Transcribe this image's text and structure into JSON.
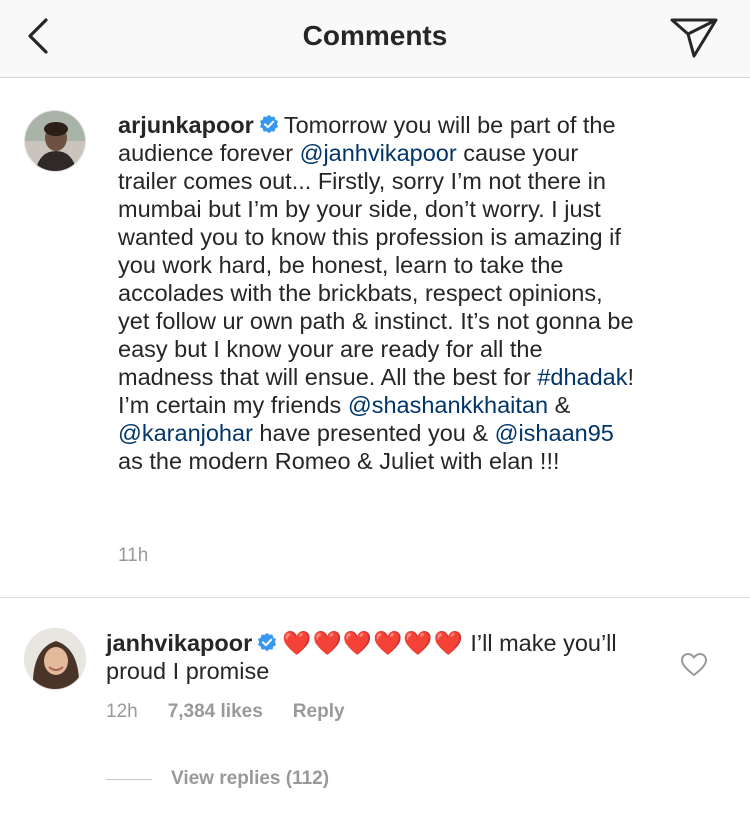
{
  "header": {
    "title": "Comments",
    "back_icon": "chevron-left-icon",
    "send_icon": "paper-plane-icon"
  },
  "comments": [
    {
      "username": "arjunkapoor",
      "verified": true,
      "segments": [
        {
          "text": "Tomorrow you will be part of the audience forever ",
          "type": "text"
        },
        {
          "text": "@janhvikapoor",
          "type": "mention"
        },
        {
          "text": " cause your trailer comes out... Firstly, sorry I’m not there in mumbai but I’m by your side, don’t worry. I just wanted you to know this profession is amazing if you work hard, be honest, learn to take the accolades with the brickbats, respect opinions, yet follow ur own path & instinct. It’s not gonna be easy but I know your are ready for all the madness that will ensue. All the best for ",
          "type": "text"
        },
        {
          "text": "#dhadak",
          "type": "mention"
        },
        {
          "text": "! I’m certain my friends ",
          "type": "text"
        },
        {
          "text": "@shashankkhaitan",
          "type": "mention"
        },
        {
          "text": " & ",
          "type": "text"
        },
        {
          "text": "@karanjohar",
          "type": "mention"
        },
        {
          "text": " have presented you & ",
          "type": "text"
        },
        {
          "text": "@ishaan95",
          "type": "mention"
        },
        {
          "text": " as the modern Romeo & Juliet with elan !!!",
          "type": "text"
        }
      ],
      "time": "11h"
    },
    {
      "username": "janhvikapoor",
      "verified": true,
      "hearts": "❤️❤️❤️❤️❤️❤️",
      "text": " I’ll make you’ll proud I promise",
      "time": "12h",
      "likes": "7,384 likes",
      "reply_label": "Reply",
      "view_replies": "View replies (112)"
    }
  ],
  "colors": {
    "mention": "#003569",
    "verified": "#3897f0",
    "meta": "#999999",
    "heart": "#ed1c24"
  }
}
